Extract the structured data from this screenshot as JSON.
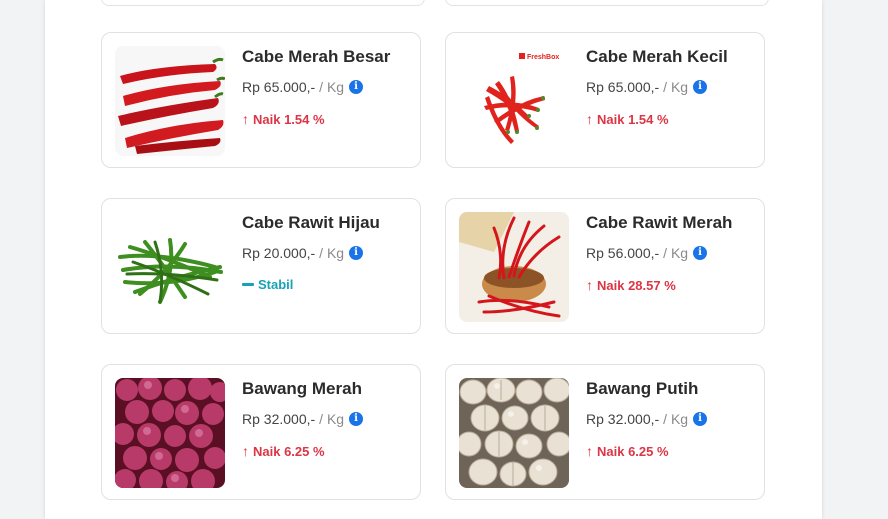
{
  "commodities": [
    {
      "name": "Cabe Merah Besar",
      "price": "Rp 65.000,-",
      "unit": "/ Kg",
      "trend": "up",
      "trend_label": "Naik 1.54 %"
    },
    {
      "name": "Cabe Merah Kecil",
      "price": "Rp 65.000,-",
      "unit": "/ Kg",
      "trend": "up",
      "trend_label": "Naik 1.54 %",
      "watermark": "FreshBox"
    },
    {
      "name": "Cabe Rawit Hijau",
      "price": "Rp 20.000,-",
      "unit": "/ Kg",
      "trend": "stable",
      "trend_label": "Stabil"
    },
    {
      "name": "Cabe Rawit Merah",
      "price": "Rp 56.000,-",
      "unit": "/ Kg",
      "trend": "up",
      "trend_label": "Naik 28.57 %"
    },
    {
      "name": "Bawang Merah",
      "price": "Rp 32.000,-",
      "unit": "/ Kg",
      "trend": "up",
      "trend_label": "Naik 6.25 %"
    },
    {
      "name": "Bawang Putih",
      "price": "Rp 32.000,-",
      "unit": "/ Kg",
      "trend": "up",
      "trend_label": "Naik 6.25 %"
    }
  ],
  "icons": {
    "info": "info-circle-icon",
    "up": "arrow-up-icon",
    "stable": "minus-icon"
  },
  "colors": {
    "up": "#dc3545",
    "stable": "#17a2b8",
    "info": "#1a73e8"
  }
}
